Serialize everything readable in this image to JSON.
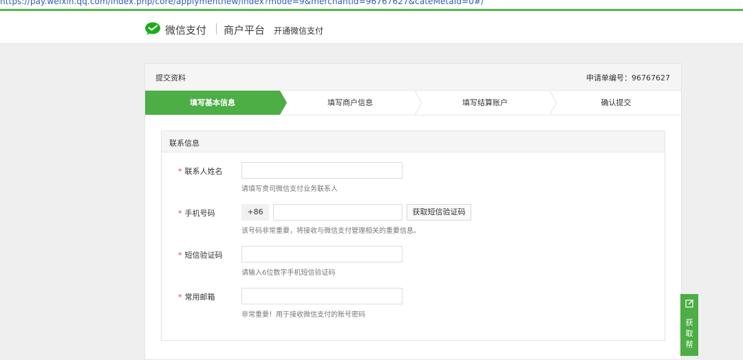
{
  "browser": {
    "url": "https://pay.weixin.qq.com/index.php/core/applymentnew/index?mode=9&merchantid=96767627&cateMetaId=0#/"
  },
  "header": {
    "brand": "微信支付",
    "platform": "商户平台",
    "subtitle": "开通微信支付"
  },
  "card": {
    "title": "提交资料",
    "order_label": "申请单编号：96767627"
  },
  "steps": [
    {
      "label": "填写基本信息",
      "active": true
    },
    {
      "label": "填写商户信息",
      "active": false
    },
    {
      "label": "填写结算账户",
      "active": false
    },
    {
      "label": "确认提交",
      "active": false
    }
  ],
  "section": {
    "title": "联系信息"
  },
  "form": {
    "required_mark": "*",
    "name": {
      "label": "联系人姓名",
      "value": "",
      "hint": "请填写贵司微信支付业务联系人"
    },
    "phone": {
      "label": "手机号码",
      "prefix": "+86",
      "value": "",
      "button": "获取短信验证码",
      "hint": "该号码非常重要，将接收与微信支付管理相关的重要信息。"
    },
    "sms": {
      "label": "短信验证码",
      "value": "",
      "hint": "请输入6位数字手机短信验证码"
    },
    "email": {
      "label": "常用邮箱",
      "value": "",
      "hint": "非常重要！用于接收微信支付的账号密码"
    }
  },
  "help_tab": {
    "label": "获取帮"
  },
  "colors": {
    "green": "#4cae44",
    "required": "#e23b3b"
  }
}
